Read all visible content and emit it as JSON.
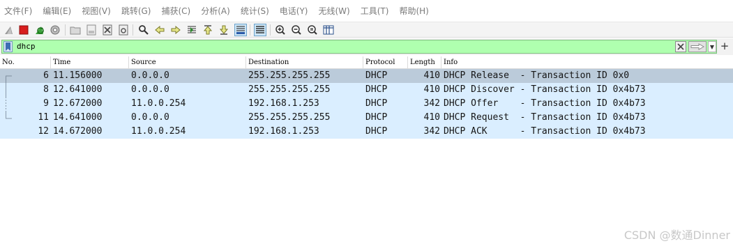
{
  "menu": [
    "文件(F)",
    "编辑(E)",
    "视图(V)",
    "跳转(G)",
    "捕获(C)",
    "分析(A)",
    "统计(S)",
    "电话(Y)",
    "无线(W)",
    "工具(T)",
    "帮助(H)"
  ],
  "filter": {
    "value": "dhcp"
  },
  "columns": [
    "No.",
    "Time",
    "Source",
    "Destination",
    "Protocol",
    "Length",
    "Info"
  ],
  "packets": [
    {
      "no": "6",
      "time": "11.156000",
      "source": "0.0.0.0",
      "destination": "255.255.255.255",
      "protocol": "DHCP",
      "length": "410",
      "info": "DHCP Release  - Transaction ID 0x0"
    },
    {
      "no": "8",
      "time": "12.641000",
      "source": "0.0.0.0",
      "destination": "255.255.255.255",
      "protocol": "DHCP",
      "length": "410",
      "info": "DHCP Discover - Transaction ID 0x4b73"
    },
    {
      "no": "9",
      "time": "12.672000",
      "source": "11.0.0.254",
      "destination": "192.168.1.253",
      "protocol": "DHCP",
      "length": "342",
      "info": "DHCP Offer    - Transaction ID 0x4b73"
    },
    {
      "no": "11",
      "time": "14.641000",
      "source": "0.0.0.0",
      "destination": "255.255.255.255",
      "protocol": "DHCP",
      "length": "410",
      "info": "DHCP Request  - Transaction ID 0x4b73"
    },
    {
      "no": "12",
      "time": "14.672000",
      "source": "11.0.0.254",
      "destination": "192.168.1.253",
      "protocol": "DHCP",
      "length": "342",
      "info": "DHCP ACK      - Transaction ID 0x4b73"
    }
  ],
  "selected_row": 0,
  "watermark": "CSDN @数通Dinner",
  "colors": {
    "filter_valid": "#afffaf",
    "row_bg": "#daeeff",
    "row_selected": "#bbcbda"
  }
}
